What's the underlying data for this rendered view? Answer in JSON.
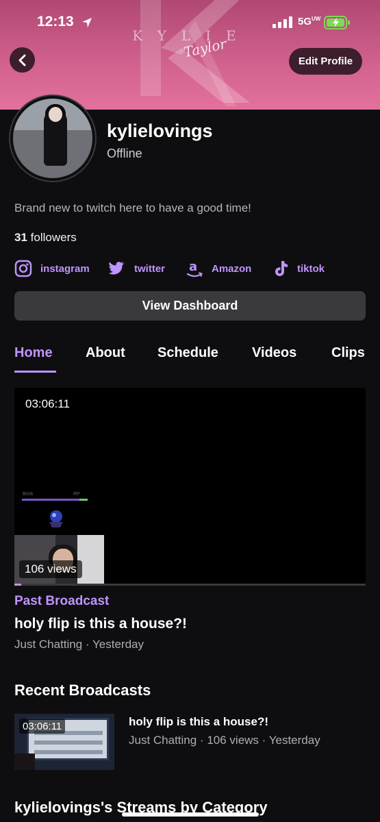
{
  "status_bar": {
    "time": "12:13",
    "network": "5G",
    "network_super": "UW"
  },
  "banner": {
    "word": "KYLIE",
    "script": "Taylor"
  },
  "header": {
    "edit_label": "Edit Profile"
  },
  "profile": {
    "username": "kylielovings",
    "presence": "Offline",
    "bio": "Brand new to twitch here to have a good time!",
    "followers_count": "31",
    "followers_label": " followers"
  },
  "socials": [
    {
      "icon": "instagram-icon",
      "label": "instagram"
    },
    {
      "icon": "twitter-icon",
      "label": "twitter"
    },
    {
      "icon": "amazon-icon",
      "label": "Amazon"
    },
    {
      "icon": "tiktok-icon",
      "label": "tiktok"
    }
  ],
  "dashboard_label": "View Dashboard",
  "tabs": [
    {
      "label": "Home",
      "active": true
    },
    {
      "label": "About",
      "active": false
    },
    {
      "label": "Schedule",
      "active": false
    },
    {
      "label": "Videos",
      "active": false
    },
    {
      "label": "Clips",
      "active": false
    }
  ],
  "featured": {
    "duration": "03:06:11",
    "views": "106 views",
    "progress_fraction": 0.02,
    "hud_left": "Brick",
    "hud_right": "RP",
    "type_label": "Past Broadcast",
    "title": "holy flip is this a house?!",
    "meta": "Just Chatting · Yesterday"
  },
  "recent": {
    "heading": "Recent Broadcasts",
    "items": [
      {
        "duration": "03:06:11",
        "title": "holy flip is this a house?!",
        "meta": "Just Chatting · 106 views · Yesterday"
      }
    ]
  },
  "streams_heading": "kylielovings's Streams by Category",
  "colors": {
    "accent": "#bf94ff",
    "background": "#0e0e10",
    "banner": "#d0608d",
    "button": "#3a3a3d"
  }
}
